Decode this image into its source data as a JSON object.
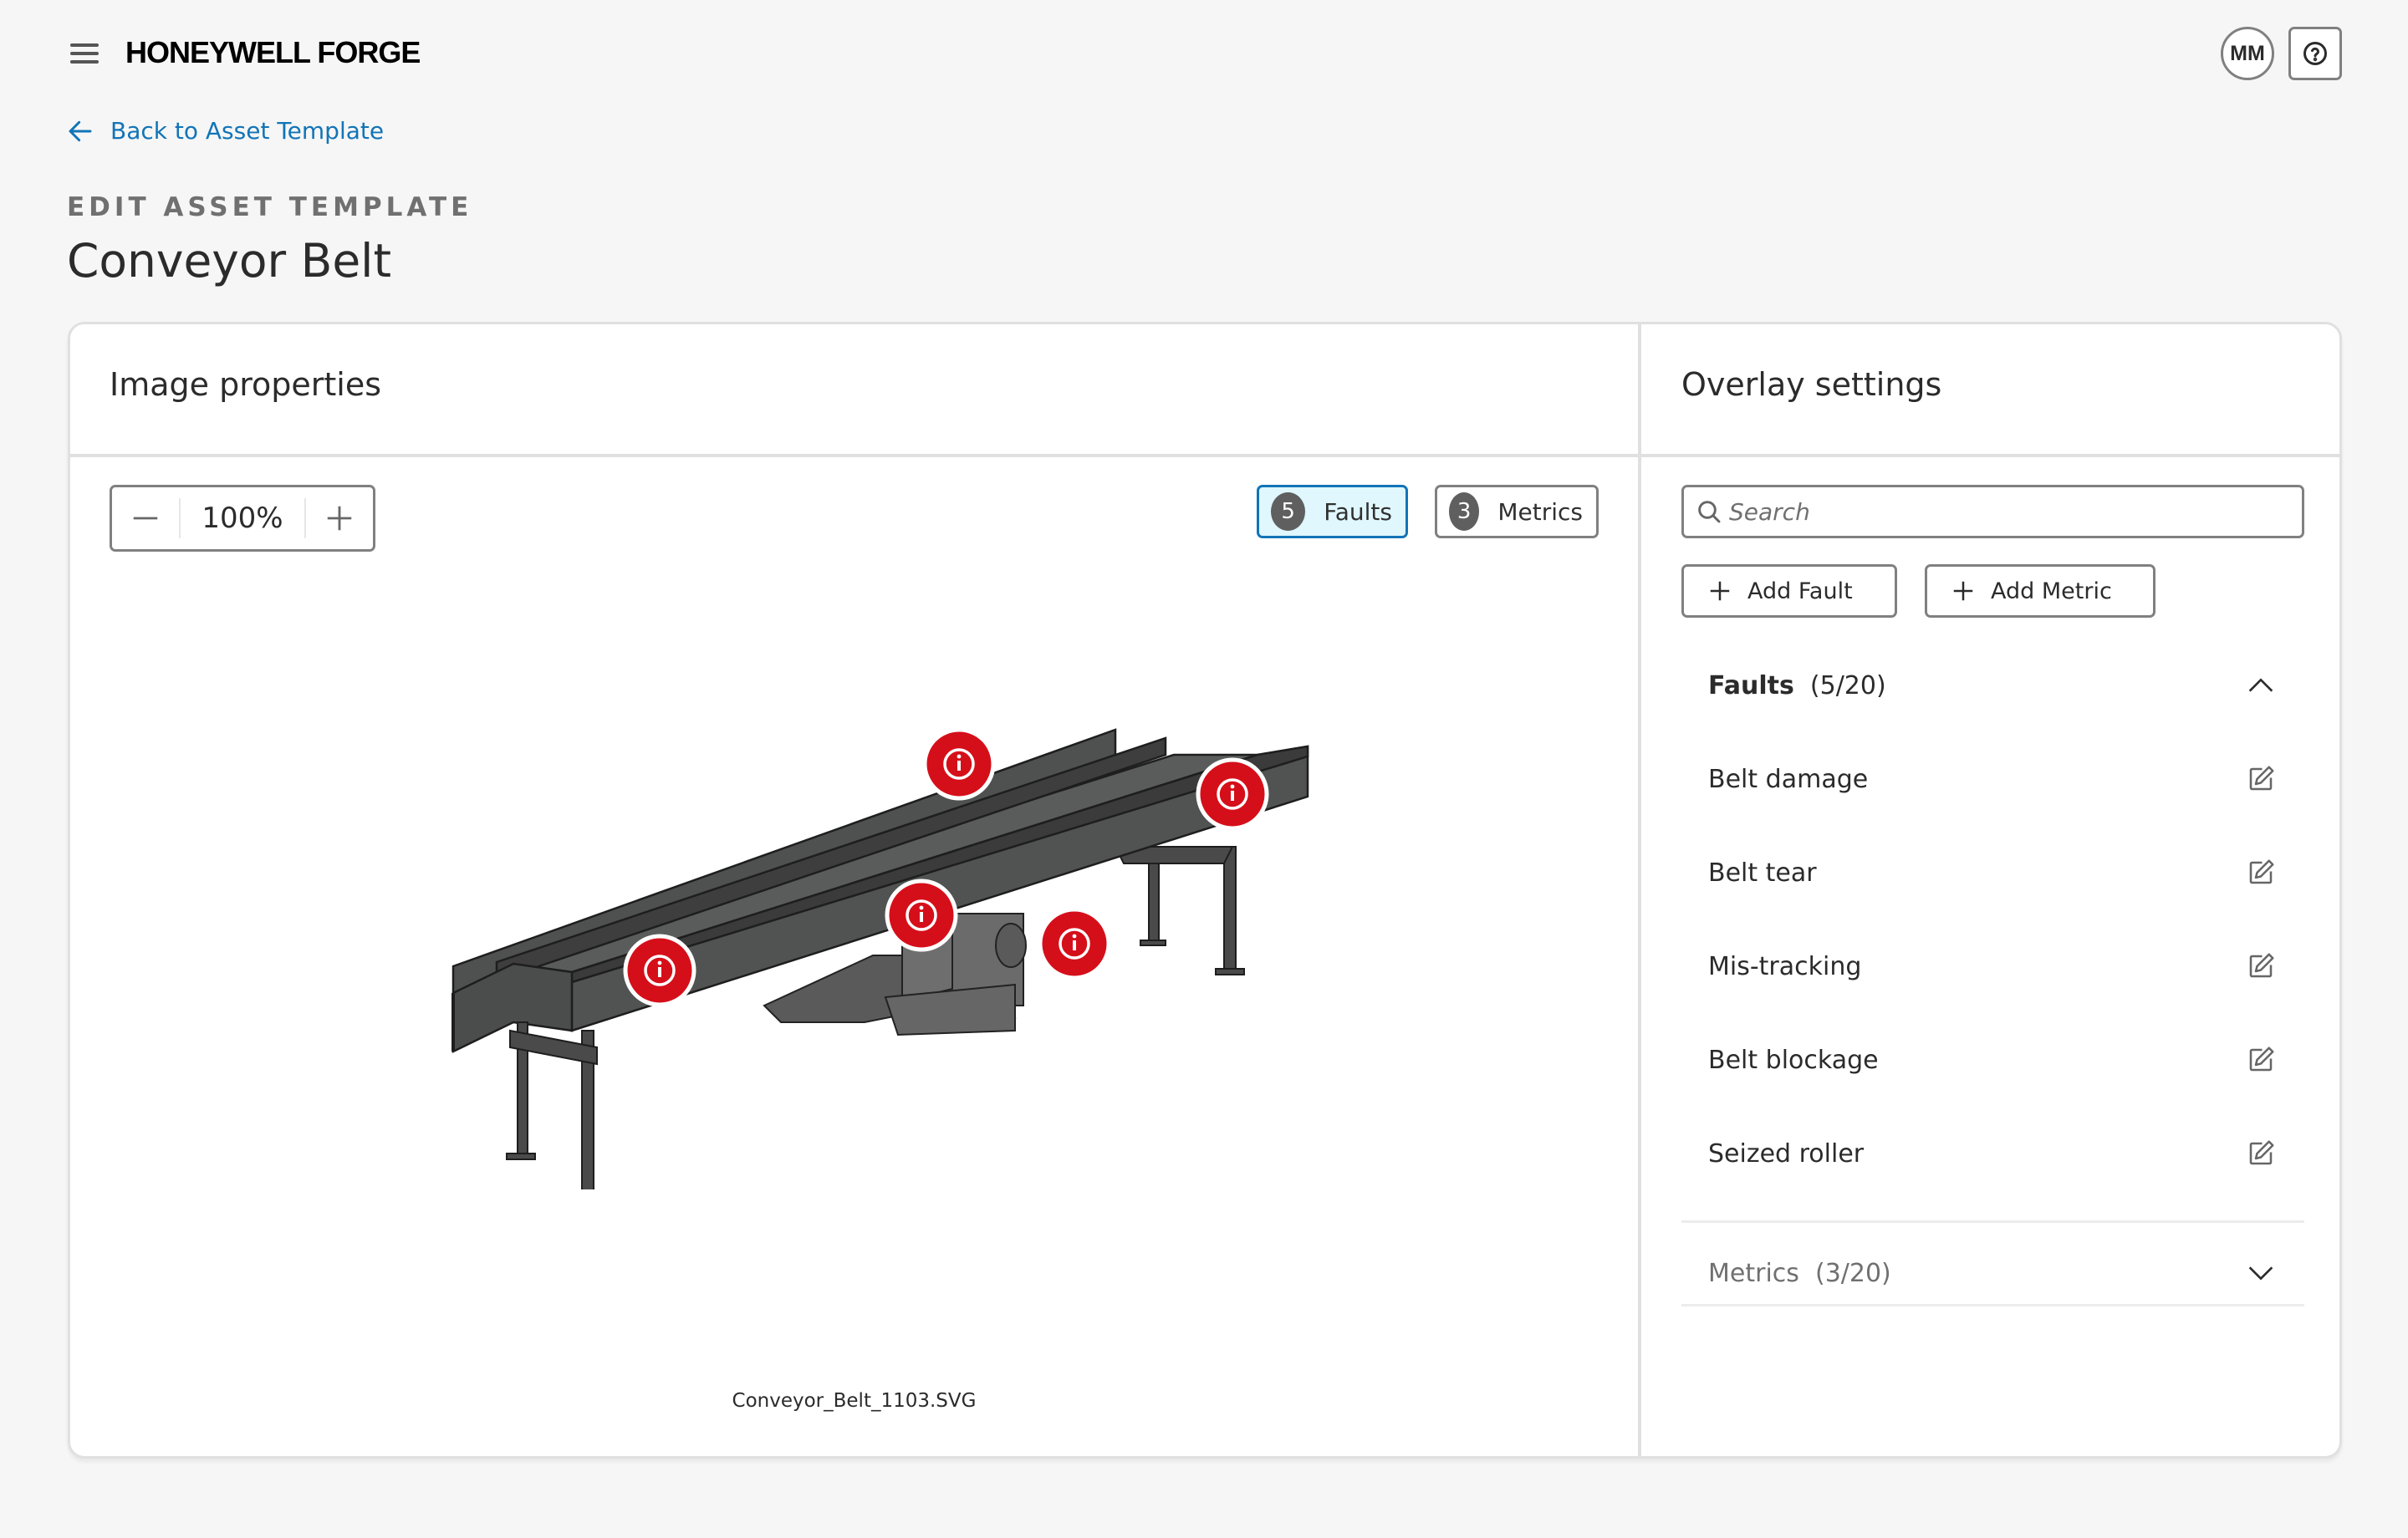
{
  "app": {
    "brand": "HONEYWELL FORGE",
    "user_initials": "MM"
  },
  "nav": {
    "back_label": "Back to Asset Template"
  },
  "page": {
    "eyebrow": "EDIT ASSET TEMPLATE",
    "title": "Conveyor Belt"
  },
  "image_panel": {
    "title": "Image properties",
    "zoom_value": "100%",
    "faults_chip": {
      "count": "5",
      "label": "Faults"
    },
    "metrics_chip": {
      "count": "3",
      "label": "Metrics"
    },
    "filename": "Conveyor_Belt_1103.SVG",
    "marker_color": "#d50f1a",
    "fault_marker_count": 5
  },
  "overlay_panel": {
    "title": "Overlay settings",
    "search_placeholder": "Search",
    "add_fault_label": "Add Fault",
    "add_metric_label": "Add Metric",
    "faults_section": {
      "label": "Faults",
      "count": "(5/20)",
      "expanded": true,
      "items": [
        {
          "label": "Belt damage"
        },
        {
          "label": "Belt tear"
        },
        {
          "label": "Mis-tracking"
        },
        {
          "label": "Belt blockage"
        },
        {
          "label": "Seized roller"
        }
      ]
    },
    "metrics_section": {
      "label": "Metrics",
      "count": "(3/20)",
      "expanded": false
    }
  },
  "colors": {
    "accent_link": "#1274b7",
    "chip_active_bg": "#dff7fd",
    "fault_marker": "#d50f1a"
  }
}
